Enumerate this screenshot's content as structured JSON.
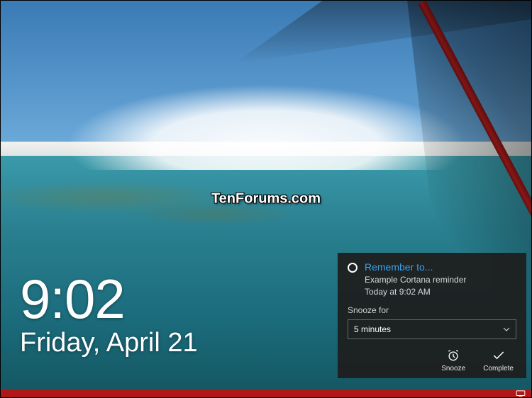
{
  "watermark": "TenForums.com",
  "clock": {
    "time": "9:02",
    "date": "Friday, April 21"
  },
  "notification": {
    "title": "Remember to...",
    "body_line1": "Example Cortana reminder",
    "body_line2": "Today at 9:02 AM",
    "snooze_label": "Snooze for",
    "snooze_value": "5 minutes",
    "actions": {
      "snooze": "Snooze",
      "complete": "Complete"
    }
  }
}
